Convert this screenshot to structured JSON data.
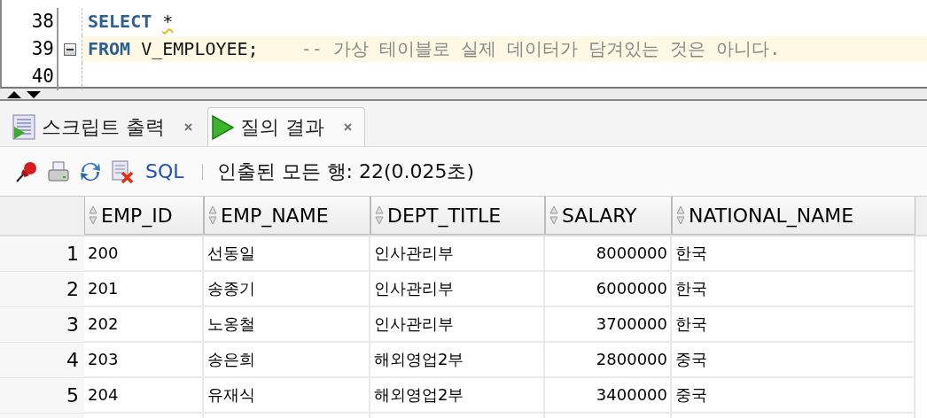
{
  "editor": {
    "lines": [
      {
        "number": "38",
        "current": false,
        "foldable": false,
        "tokens": [
          {
            "kind": "keyword",
            "text": "SELECT",
            "warning": false
          },
          {
            "kind": "plain",
            "text": "*",
            "warning": true
          }
        ]
      },
      {
        "number": "39",
        "current": true,
        "foldable": true,
        "tokens": [
          {
            "kind": "keyword",
            "text": "FROM",
            "warning": false
          },
          {
            "kind": "plain",
            "text": "V_EMPLOYEE;",
            "warning": false
          },
          {
            "kind": "comment",
            "text": "-- 가상 테이블로 실제 데이터가 담겨있는 것은 아니다.",
            "warning": false
          }
        ]
      },
      {
        "number": "40",
        "current": false,
        "foldable": false
      }
    ]
  },
  "tabs": [
    {
      "label": "스크립트 출력",
      "kind": "script",
      "selected": false
    },
    {
      "label": "질의 결과",
      "kind": "query",
      "selected": true
    }
  ],
  "toolbar": {
    "sql_link": "SQL",
    "status": "인출된 모든 행: 22(0.025초)"
  },
  "table": {
    "columns": [
      {
        "label": "EMP_ID",
        "kind": "text"
      },
      {
        "label": "EMP_NAME",
        "kind": "text"
      },
      {
        "label": "DEPT_TITLE",
        "kind": "text"
      },
      {
        "label": "SALARY",
        "kind": "number"
      },
      {
        "label": "NATIONAL_NAME",
        "kind": "text"
      }
    ],
    "rows": [
      {
        "number": "1",
        "cells": [
          "200",
          "선동일",
          "인사관리부",
          "8000000",
          "한국"
        ]
      },
      {
        "number": "2",
        "cells": [
          "201",
          "송종기",
          "인사관리부",
          "6000000",
          "한국"
        ]
      },
      {
        "number": "3",
        "cells": [
          "202",
          "노옹철",
          "인사관리부",
          "3700000",
          "한국"
        ]
      },
      {
        "number": "4",
        "cells": [
          "203",
          "송은희",
          "해외영업2부",
          "2800000",
          "중국"
        ]
      },
      {
        "number": "5",
        "cells": [
          "204",
          "유재식",
          "해외영업2부",
          "3400000",
          "중국"
        ]
      }
    ]
  }
}
